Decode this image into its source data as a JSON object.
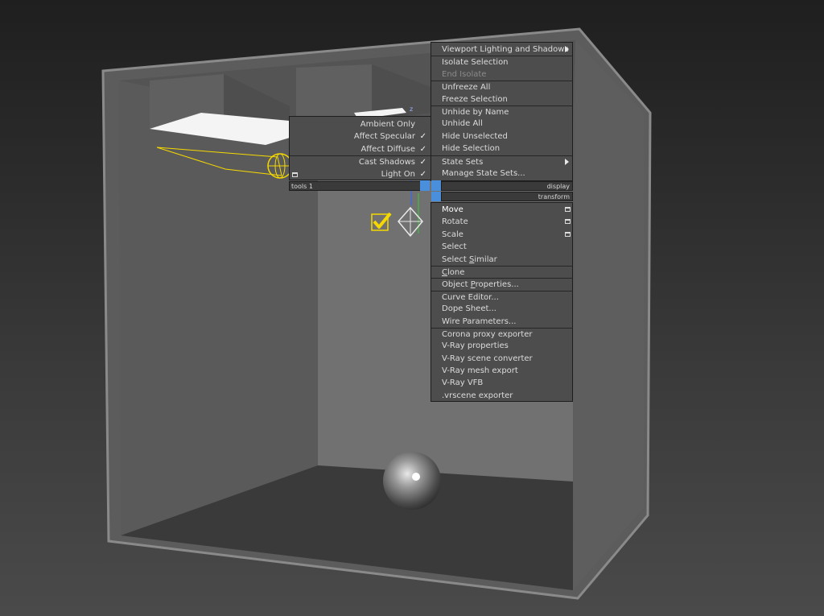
{
  "quad_menu": {
    "top_items": [
      {
        "label": "Viewport Lighting and Shadows",
        "submenu": true
      },
      {
        "label": "Isolate Selection"
      },
      {
        "label": "End Isolate",
        "disabled": true
      },
      {
        "label": "Unfreeze All"
      },
      {
        "label": "Freeze Selection"
      },
      {
        "label": "Unhide by Name"
      },
      {
        "label": "Unhide All"
      },
      {
        "label": "Hide Unselected"
      },
      {
        "label": "Hide Selection"
      },
      {
        "label": "State Sets",
        "submenu": true
      },
      {
        "label": "Manage State Sets..."
      }
    ],
    "headers": {
      "tools": "tools 1",
      "display": "display",
      "transform": "transform"
    },
    "bottom_items": [
      {
        "label": "Move"
      },
      {
        "label": "Rotate"
      },
      {
        "label": "Scale"
      },
      {
        "label": "Select"
      },
      {
        "label_pre": "Select ",
        "label_ul": "S",
        "label_post": "imilar"
      },
      {
        "label_pre": "",
        "label_ul": "C",
        "label_post": "lone"
      },
      {
        "label_pre": "Object ",
        "label_ul": "P",
        "label_post": "roperties..."
      },
      {
        "label": "Curve Editor..."
      },
      {
        "label": "Dope Sheet..."
      },
      {
        "label": "Wire Parameters..."
      },
      {
        "label": "Corona proxy exporter"
      },
      {
        "label": "V-Ray properties"
      },
      {
        "label": "V-Ray scene converter"
      },
      {
        "label": "V-Ray mesh export"
      },
      {
        "label": "V-Ray VFB"
      },
      {
        "label": ".vrscene exporter"
      }
    ],
    "left_items": [
      {
        "label": "Ambient Only",
        "checked": false
      },
      {
        "label": "Affect Specular",
        "checked": true
      },
      {
        "label": "Affect Diffuse",
        "checked": true
      },
      {
        "label": "Cast Shadows",
        "checked": true
      },
      {
        "label": "Light On",
        "checked": true
      }
    ],
    "check_glyph": "✓"
  },
  "viewport": {
    "axis_label": "z",
    "colors": {
      "accent_blue": "#4a8fdb",
      "selection_yellow": "#f5d800"
    }
  }
}
